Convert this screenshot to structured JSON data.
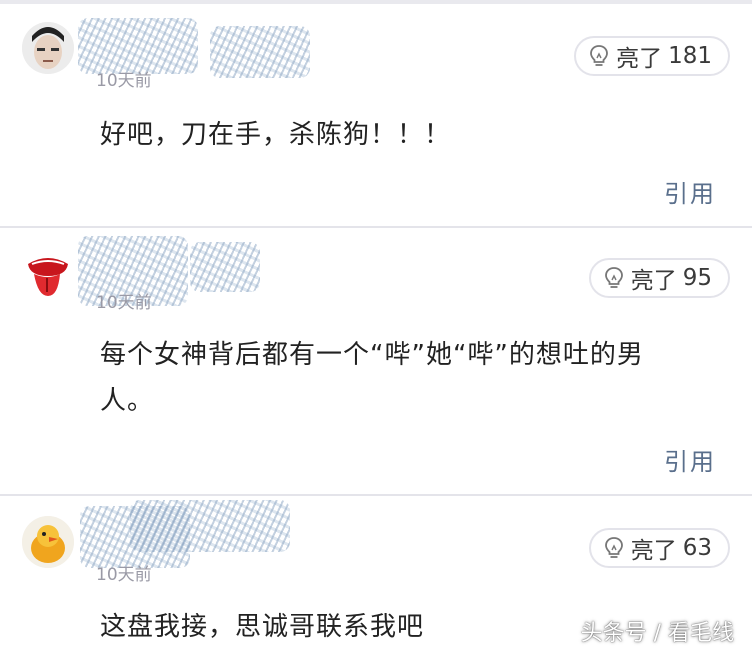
{
  "comments": [
    {
      "time": "10天前",
      "like_label": "亮了",
      "like_count": "181",
      "text": "好吧，刀在手，杀陈狗！！！",
      "quote_label": "引用",
      "avatar_icon": "male-face-avatar-icon"
    },
    {
      "time": "10天前",
      "like_label": "亮了",
      "like_count": "95",
      "text": "每个女神背后都有一个“哔”她“哔”的想吐的男人。",
      "quote_label": "引用",
      "avatar_icon": "red-tongue-logo-avatar-icon"
    },
    {
      "time": "10天前",
      "like_label": "亮了",
      "like_count": "63",
      "text": "这盘我接，思诚哥联系我吧",
      "avatar_icon": "orange-duck-avatar-icon"
    }
  ],
  "watermark": "头条号 / 看毛线",
  "colors": {
    "quote": "#5a6f8c",
    "time": "#9a9aa6",
    "separator": "#e4e4ea"
  }
}
